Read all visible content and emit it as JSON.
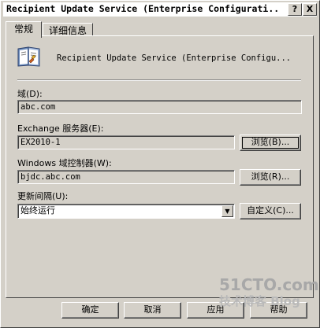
{
  "window": {
    "title": "Recipient Update Service (Enterprise Configurati...",
    "help_label": "?",
    "close_label": "X"
  },
  "tabs": [
    {
      "label": "常规",
      "active": true
    },
    {
      "label": "详细信息",
      "active": false
    }
  ],
  "header": {
    "icon": "address-book-icon",
    "label": "Recipient Update Service (Enterprise Configu..."
  },
  "fields": {
    "domain": {
      "label": "域(D):",
      "value": "abc.com"
    },
    "exchange_server": {
      "label": "Exchange 服务器(E):",
      "value": "EX2010-1",
      "browse_label": "浏览(B)..."
    },
    "windows_dc": {
      "label": "Windows 域控制器(W):",
      "value": "bjdc.abc.com",
      "browse_label": "浏览(R)..."
    },
    "update_interval": {
      "label": "更新间隔(U):",
      "value": "始终运行",
      "custom_label": "自定义(C)..."
    }
  },
  "buttons": {
    "ok": "确定",
    "cancel": "取消",
    "apply": "应用",
    "help": "帮助"
  },
  "watermark": {
    "line1": "51CTO.com",
    "line2": "技术博客 Blog"
  }
}
